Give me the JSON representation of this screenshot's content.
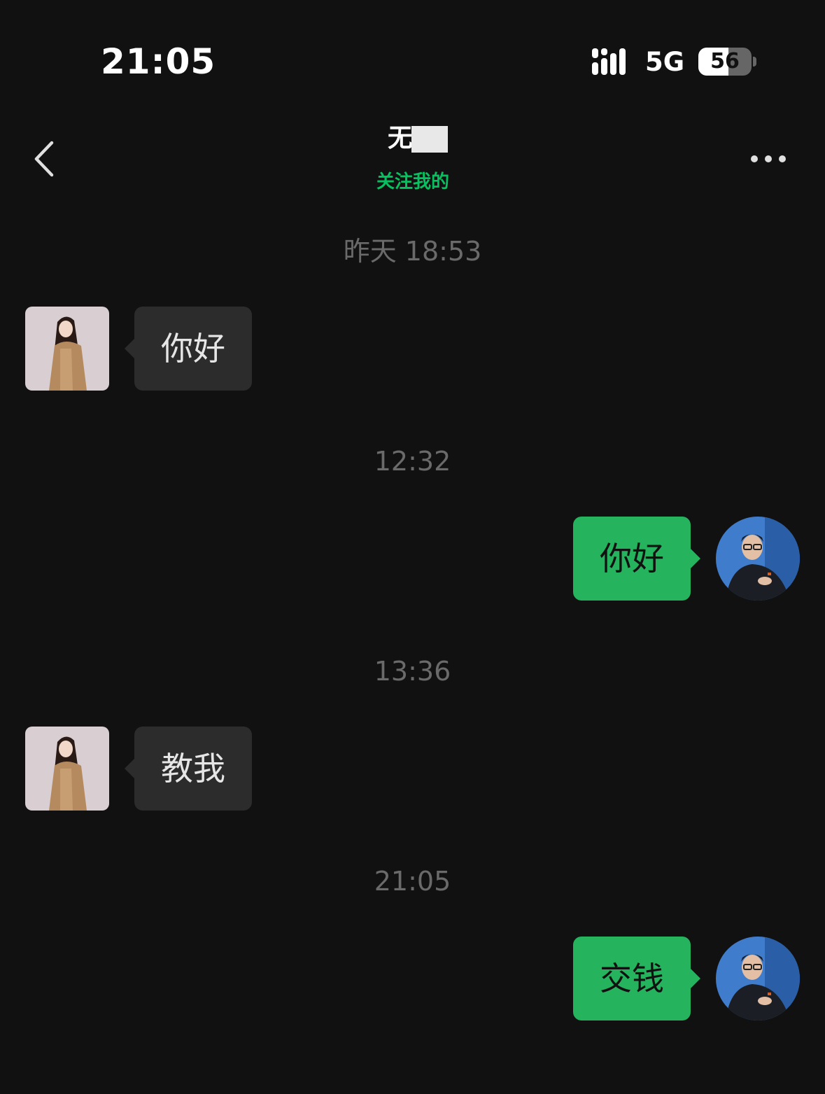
{
  "status_bar": {
    "time": "21:05",
    "network": "5G",
    "battery": "56",
    "battery_level_percent": 56,
    "signal_icon": "signal-bars-icon"
  },
  "nav": {
    "title": "无臣",
    "subtitle": "关注我的",
    "back_icon": "chevron-left-icon",
    "more_icon": "more-dots-icon",
    "subtitle_color": "#07c160"
  },
  "messages": [
    {
      "time": "昨天 18:53",
      "direction": "incoming",
      "text": "你好"
    },
    {
      "time": "12:32",
      "direction": "outgoing",
      "text": "你好"
    },
    {
      "time": "13:36",
      "direction": "incoming",
      "text": "教我"
    },
    {
      "time": "21:05",
      "direction": "outgoing",
      "text": "交钱"
    }
  ],
  "colors": {
    "background": "#111111",
    "incoming_bubble": "#2c2c2c",
    "outgoing_bubble": "#25b35e",
    "timestamp": "#6a6a6a"
  }
}
